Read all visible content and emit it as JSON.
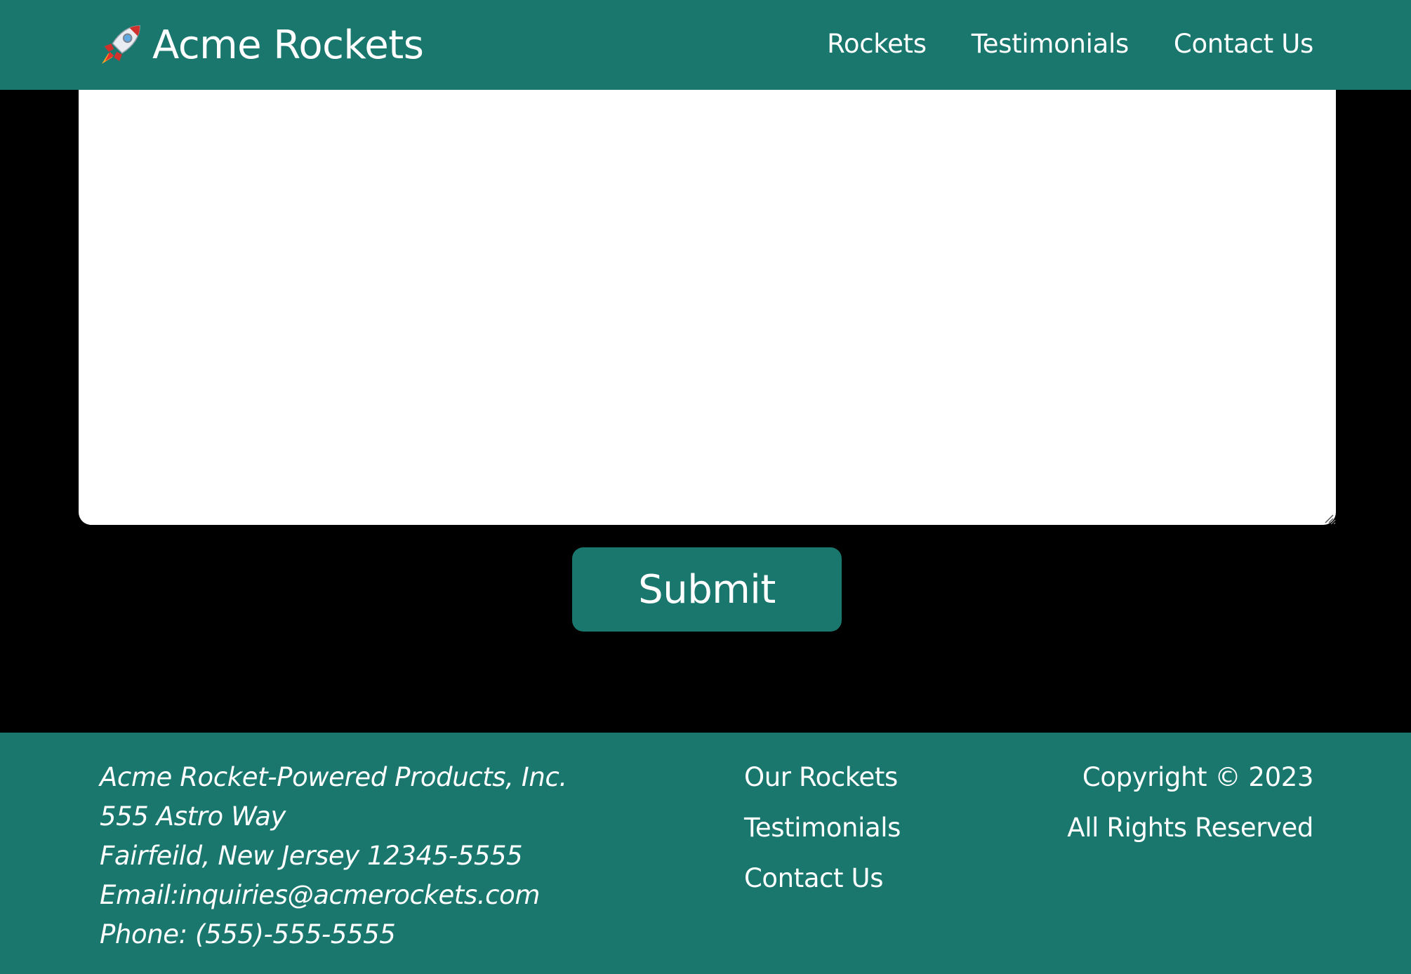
{
  "header": {
    "brand_name": "Acme Rockets",
    "brand_icon": "rocket-icon",
    "nav": [
      {
        "label": "Rockets"
      },
      {
        "label": "Testimonials"
      },
      {
        "label": "Contact Us"
      }
    ]
  },
  "form": {
    "message_value": "",
    "submit_label": "Submit"
  },
  "footer": {
    "address": {
      "company": "Acme Rocket-Powered Products, Inc.",
      "street": "555 Astro Way",
      "city": "Fairfeild, New Jersey 12345-5555",
      "email": "Email:inquiries@acmerockets.com",
      "phone": "Phone: (555)-555-5555"
    },
    "links": [
      {
        "label": "Our Rockets"
      },
      {
        "label": "Testimonials"
      },
      {
        "label": "Contact Us"
      }
    ],
    "copyright": "Copyright © 2023",
    "rights": "All Rights Reserved"
  },
  "colors": {
    "brand": "#1a776e",
    "background": "#000000",
    "text_on_brand": "#ffffff"
  }
}
